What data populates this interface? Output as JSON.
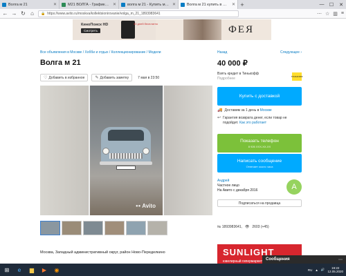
{
  "browser": {
    "tabs": [
      {
        "label": "Волга м 21",
        "color": "#0a7dc4"
      },
      {
        "label": "M21 ВОЛГА - Графика выпуска",
        "color": "#2e8b57"
      },
      {
        "label": "волга м 21 - Купить модели авто...",
        "color": "#0a7dc4"
      },
      {
        "label": "Волга м 21 купить в Москве на...",
        "color": "#0a7dc4",
        "active": true
      }
    ],
    "url": "https://www.avito.ru/moskva/kollektsionirovanie/volga_m_21_1893983641"
  },
  "banner": {
    "brand": "КиноПоиск HD",
    "watch": "Смотреть",
    "promo": "30 дней бесплатно",
    "title": "ФЕЯ"
  },
  "breadcrumbs": "Все объявления в Москве / Хобби и отдых / Коллекционирование / Модели",
  "nav": {
    "back": "Назад",
    "next": "Следующее ›"
  },
  "listing": {
    "title": "Волга м 21",
    "price": "40 000 ₽",
    "add_favorite": "Добавить в избранное",
    "add_note": "Добавить заметку",
    "date": "7 мая в 23:50",
    "watermark": "Avito",
    "address": "Москва, Западный административный округ, район Ново-Переделкино"
  },
  "credit": {
    "text": "Взять кредит в Тинькофф",
    "more": "Подробнее",
    "logo": "ТИНЬКОФФ"
  },
  "buttons": {
    "buy": "Купить с доставкой",
    "phone": "Показать телефон",
    "phone_sub": "8 926 XXX-XX-XX",
    "message": "Написать сообщение",
    "message_sub": "Отвечает около часа",
    "subscribe": "Подписаться на продавца"
  },
  "delivery": {
    "text": "Доставим за 1 день в ",
    "city": "Москве"
  },
  "guarantee": {
    "text": "Гарантия возврата денег, если товар не подойдет. ",
    "link": "Как это работает"
  },
  "seller": {
    "name": "Андрей",
    "type": "Частное лицо",
    "since": "На Авито с декабря 2016",
    "initial": "А"
  },
  "meta": {
    "id": "№ 1893983641,",
    "views": "2603 (+45)"
  },
  "ad2": {
    "title": "SUNLIGHT",
    "sub": "ювелирный гипермаркет"
  },
  "notification": {
    "title": "Сообщения"
  },
  "taskbar": {
    "lang": "RU",
    "time": "19:22",
    "date": "12.05.2020"
  },
  "thumbnails": [
    {
      "color": "#8a97a0",
      "active": true
    },
    {
      "color": "#9a8c78"
    },
    {
      "color": "#7e8a92"
    },
    {
      "color": "#a08e7a"
    },
    {
      "color": "#8fa3b0"
    },
    {
      "color": "#b5b2aa"
    }
  ]
}
